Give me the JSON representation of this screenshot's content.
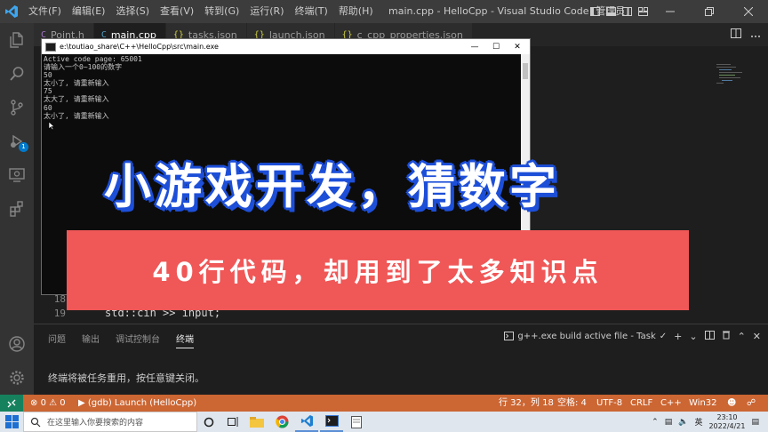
{
  "window": {
    "title": "main.cpp - HelloCpp - Visual Studio Code [管理员]",
    "menu": [
      "文件(F)",
      "编辑(E)",
      "选择(S)",
      "查看(V)",
      "转到(G)",
      "运行(R)",
      "终端(T)",
      "帮助(H)"
    ]
  },
  "activity": {
    "icons": [
      "explorer-icon",
      "search-icon",
      "source-control-icon",
      "run-debug-icon",
      "remote-explorer-icon",
      "extensions-icon",
      "account-icon",
      "settings-gear-icon"
    ],
    "debug_badge": "1"
  },
  "tabs": [
    {
      "label": "Point.h",
      "icon": "C",
      "active": false
    },
    {
      "label": "main.cpp",
      "icon": "C",
      "active": true
    },
    {
      "label": "tasks.json",
      "icon": "{}",
      "active": false
    },
    {
      "label": "launch.json",
      "icon": "{}",
      "active": false
    },
    {
      "label": "c_cpp_properties.json",
      "icon": "{}",
      "active": false
    }
  ],
  "code": {
    "lines": [
      {
        "number": "18",
        "text": ""
      },
      {
        "number": "19",
        "text": "std::cin >> input;"
      }
    ]
  },
  "console": {
    "title": "e:\\toutiao_share\\C++\\HelloCpp\\src\\main.exe",
    "lines": [
      "Active code page: 65001",
      "请输入一个0~100的数字",
      "50",
      "太小了, 请重新输入",
      "75",
      "太大了, 请重新输入",
      "60",
      "太小了, 请重新输入"
    ]
  },
  "overlay": {
    "headline": "小游戏开发，猜数字",
    "subline": "40行代码，却用到了太多知识点",
    "headline_outline": "#1d4fd8",
    "subline_bg": "#f05757"
  },
  "panel": {
    "tabs": [
      "问题",
      "输出",
      "调试控制台",
      "终端"
    ],
    "active_tab": "终端",
    "terminal_select": "g++.exe build active file - Task",
    "message": "终端将被任务重用，按任意键关闭。"
  },
  "status": {
    "errors": "0",
    "warnings": "0",
    "launch": "(gdb) Launch (HelloCpp)",
    "position": "行 32，列 18",
    "spaces": "空格: 4",
    "encoding": "UTF-8",
    "eol": "CRLF",
    "language": "C++",
    "platform": "Win32",
    "color": "#cc6633"
  },
  "taskbar": {
    "search_placeholder": "在这里输入你要搜索的内容",
    "ime": "英",
    "time": "23:10",
    "date": "2022/4/21"
  }
}
